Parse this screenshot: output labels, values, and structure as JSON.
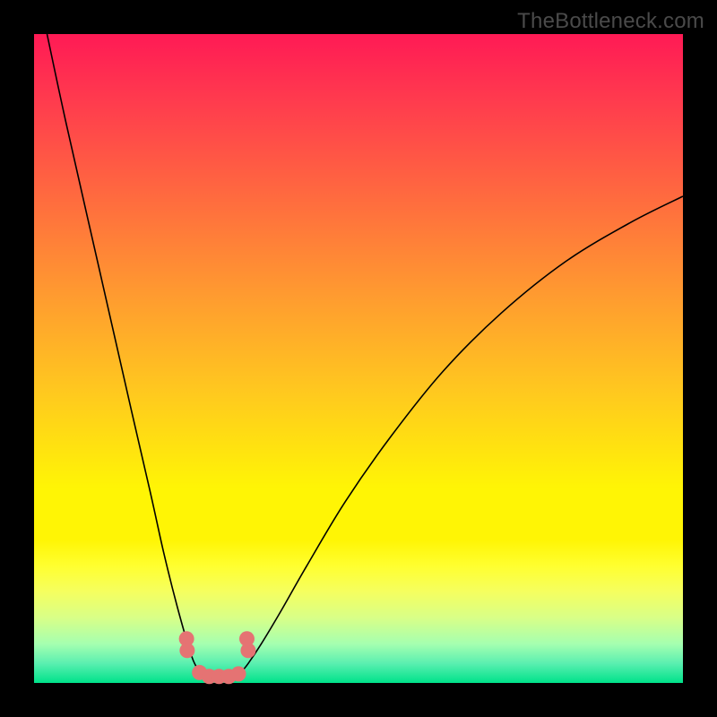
{
  "watermark": "TheBottleneck.com",
  "colors": {
    "frame": "#000000",
    "gradient_top": "#ff1a55",
    "gradient_mid": "#fff505",
    "gradient_bottom": "#00e28a",
    "curve": "#000000",
    "marker": "#e57373"
  },
  "chart_data": {
    "type": "line",
    "title": "",
    "xlabel": "",
    "ylabel": "",
    "xlim": [
      0,
      100
    ],
    "ylim": [
      0,
      100
    ],
    "x": [
      2,
      5,
      10,
      15,
      18,
      20,
      22,
      24,
      25,
      26,
      27,
      28,
      29,
      30,
      31,
      32,
      33,
      35,
      38,
      42,
      48,
      55,
      63,
      72,
      82,
      92,
      100
    ],
    "values": [
      100,
      86,
      64,
      42,
      29,
      20,
      12,
      5,
      2.5,
      1.3,
      0.9,
      0.8,
      0.8,
      0.9,
      1.2,
      1.8,
      3,
      6,
      11,
      18,
      28,
      38,
      48,
      57,
      65,
      71,
      75
    ],
    "markers": {
      "x": [
        23.5,
        23.6,
        25.5,
        27,
        28.5,
        30,
        31.5,
        33,
        32.8
      ],
      "y": [
        6.8,
        5.0,
        1.6,
        1.0,
        1.0,
        1.0,
        1.4,
        5.0,
        6.8
      ]
    }
  }
}
